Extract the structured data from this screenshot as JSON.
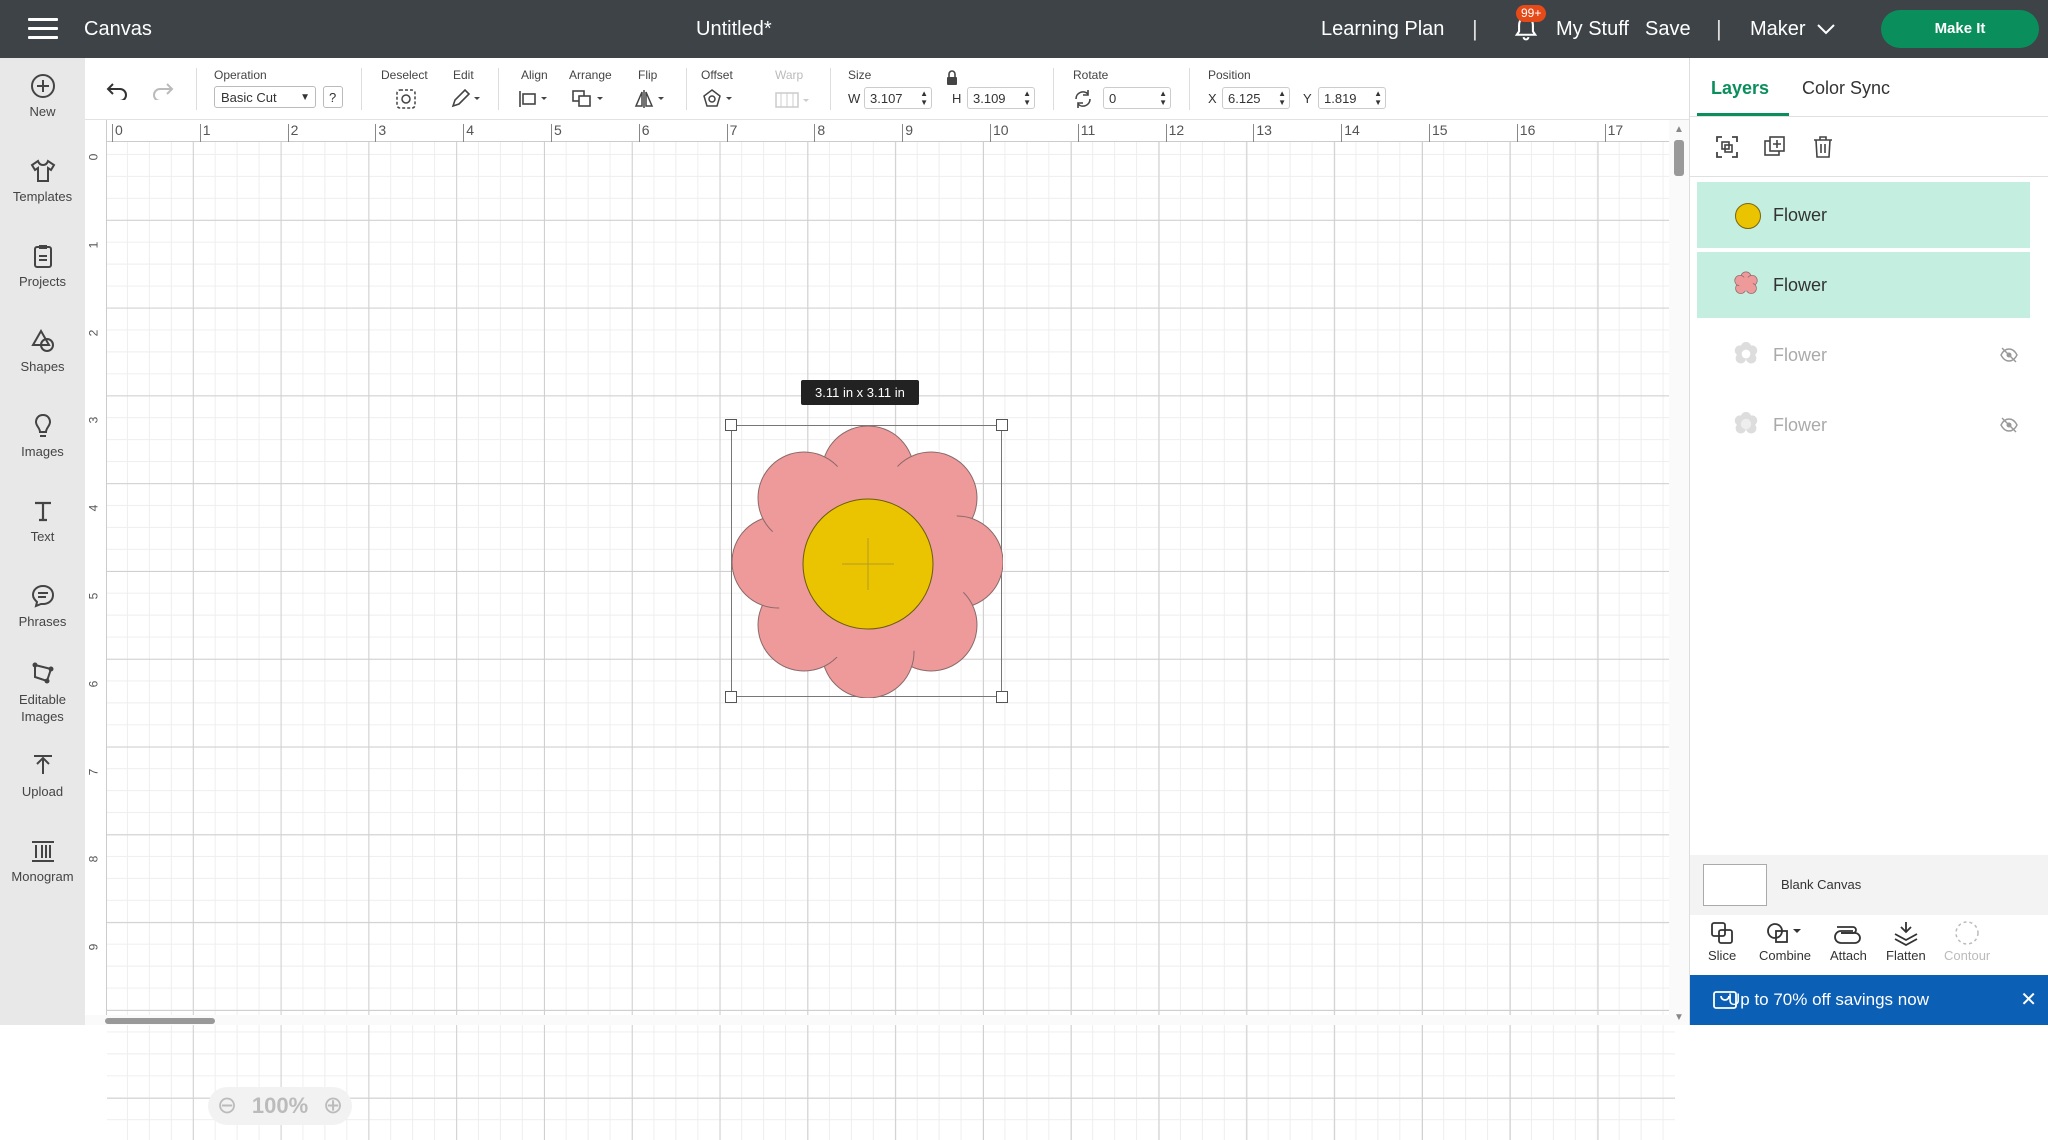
{
  "topbar": {
    "app_title": "Canvas",
    "doc_title": "Untitled*",
    "learning_plan": "Learning Plan",
    "sep": "|",
    "notif_badge": "99+",
    "my_stuff": "My Stuff",
    "save": "Save",
    "machine": "Maker",
    "make_it": "Make It"
  },
  "leftbar": {
    "items": [
      {
        "label": "New",
        "icon": "plus-circle-icon"
      },
      {
        "label": "Templates",
        "icon": "shirt-icon"
      },
      {
        "label": "Projects",
        "icon": "clipboard-icon"
      },
      {
        "label": "Shapes",
        "icon": "shapes-icon"
      },
      {
        "label": "Images",
        "icon": "bulb-icon"
      },
      {
        "label": "Text",
        "icon": "text-icon"
      },
      {
        "label": "Phrases",
        "icon": "speech-icon"
      },
      {
        "label": "Editable Images",
        "icon": "editable-icon"
      },
      {
        "label": "Upload",
        "icon": "upload-icon"
      },
      {
        "label": "Monogram",
        "icon": "monogram-icon"
      }
    ]
  },
  "toolbar": {
    "operation_label": "Operation",
    "operation_value": "Basic Cut",
    "help": "?",
    "deselect": "Deselect",
    "edit": "Edit",
    "align": "Align",
    "arrange": "Arrange",
    "flip": "Flip",
    "offset": "Offset",
    "warp": "Warp",
    "size": "Size",
    "w_label": "W",
    "w_value": "3.107",
    "h_label": "H",
    "h_value": "3.109",
    "rotate": "Rotate",
    "rotate_value": "0",
    "position": "Position",
    "x_label": "X",
    "x_value": "6.125",
    "y_label": "Y",
    "y_value": "1.819"
  },
  "canvas": {
    "ruler_x": [
      "0",
      "1",
      "2",
      "3",
      "4",
      "5",
      "6",
      "7",
      "8",
      "9",
      "10",
      "11",
      "12",
      "13",
      "14",
      "15",
      "16",
      "17"
    ],
    "ruler_y": [
      "0",
      "1",
      "2",
      "3",
      "4",
      "5",
      "6",
      "7",
      "8",
      "9"
    ],
    "size_tooltip": "3.11  in x 3.11  in",
    "zoom": "100%",
    "colors": {
      "petals": "#ee9a9a",
      "center": "#eac400"
    }
  },
  "panel": {
    "tabs": [
      "Layers",
      "Color Sync"
    ],
    "layers": [
      {
        "name": "Flower",
        "color": "#eac400",
        "state": "selected"
      },
      {
        "name": "Flower",
        "color": "#ee9a9a",
        "state": "selected"
      },
      {
        "name": "Flower",
        "color": "#cccccc",
        "state": "hidden"
      },
      {
        "name": "Flower",
        "color": "#cccccc",
        "state": "hidden"
      }
    ],
    "blank_canvas": "Blank Canvas",
    "actions": [
      "Slice",
      "Combine",
      "Attach",
      "Flatten",
      "Contour"
    ],
    "promo": "Up to 70% off savings now",
    "accent": "#0a8f5c"
  }
}
